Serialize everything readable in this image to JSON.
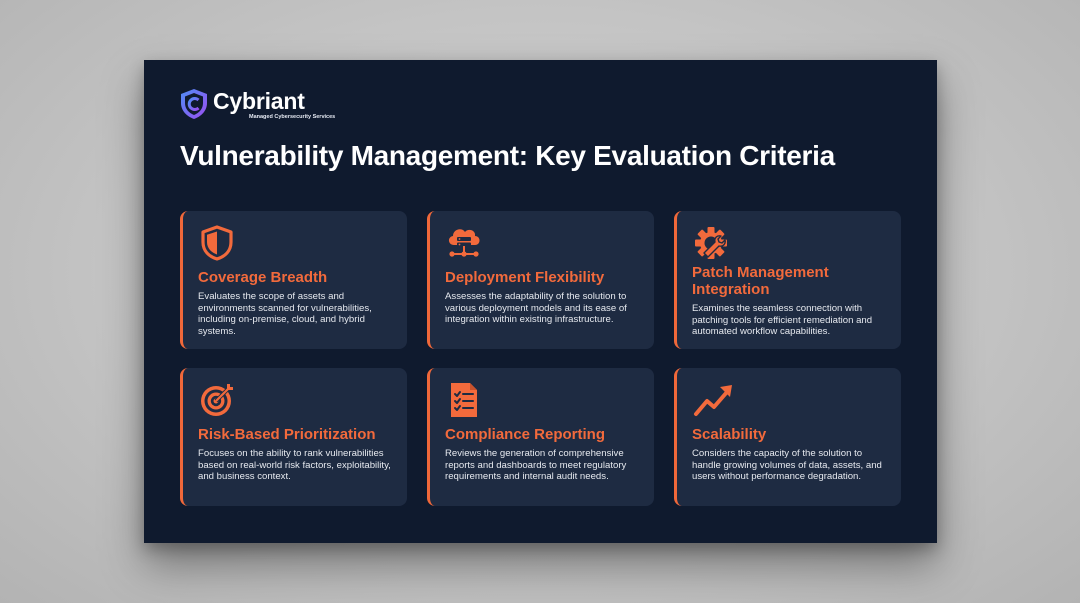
{
  "brand": {
    "name": "Cybriant",
    "tagline": "Managed Cybersecurity Services",
    "logo_icon": "shield-logo-icon"
  },
  "colors": {
    "slide_background": "#0f1a2e",
    "card_background": "#1e2b42",
    "accent": "#f26a3c",
    "text": "#ffffff"
  },
  "title": "Vulnerability Management: Key Evaluation Criteria",
  "cards": [
    {
      "icon": "shield-icon",
      "title": "Coverage Breadth",
      "description": "Evaluates the scope of assets and environments scanned for vulnerabilities, including on-premise, cloud, and hybrid systems."
    },
    {
      "icon": "cloud-server-icon",
      "title": "Deployment Flexibility",
      "description": "Assesses the adaptability of the solution to various deployment models and its ease of integration within existing infrastructure."
    },
    {
      "icon": "gear-wrench-icon",
      "title": "Patch Management Integration",
      "description": "Examines the seamless connection with patching tools for efficient remediation and automated workflow capabilities."
    },
    {
      "icon": "target-icon",
      "title": "Risk-Based Prioritization",
      "description": "Focuses on the ability to rank vulnerabilities based on real-world risk factors, exploitability, and business context."
    },
    {
      "icon": "checklist-document-icon",
      "title": "Compliance Reporting",
      "description": "Reviews the generation of comprehensive reports and dashboards to meet regulatory requirements and internal audit needs."
    },
    {
      "icon": "trend-up-icon",
      "title": "Scalability",
      "description": "Considers the capacity of the solution to handle growing volumes of data, assets, and users without performance degradation."
    }
  ]
}
